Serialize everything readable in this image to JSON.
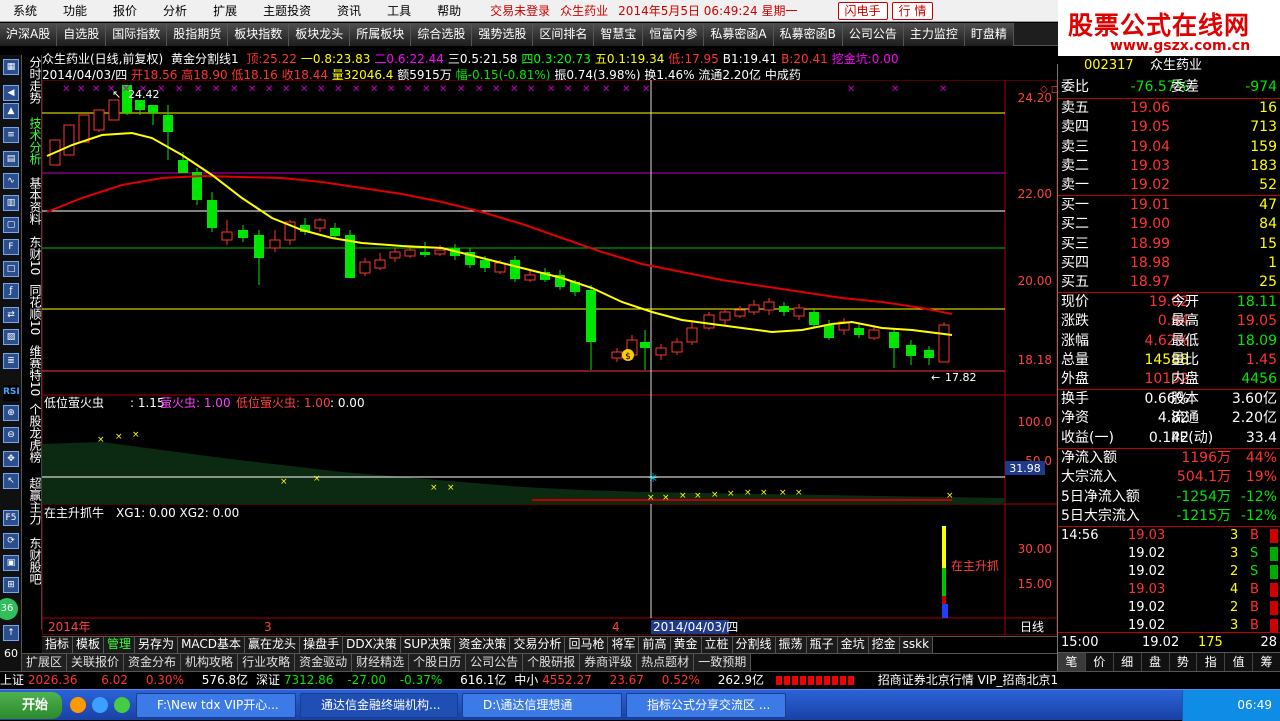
{
  "menubar": {
    "items": [
      "系统",
      "功能",
      "报价",
      "分析",
      "扩展",
      "主题投资",
      "资讯",
      "工具",
      "帮助"
    ],
    "status": "交易未登录",
    "stock": "众生药业",
    "time": "2014年5月5日 06:49:24 星期一",
    "btn1": "闪电手",
    "btn2": "行 情"
  },
  "logo": {
    "title": "股票公式在线网",
    "url": "www.gszx.com.cn"
  },
  "toolbar": [
    "沪深A股",
    "自选股",
    "国际指数",
    "股指期货",
    "板块指数",
    "板块龙头",
    "所属板块",
    "综合选股",
    "强势选股",
    "区间排名",
    "智慧宝",
    "恒富内参",
    "私募密函A",
    "私募密函B",
    "公司公告",
    "主力监控",
    "盯盘精"
  ],
  "leftbar": {
    "vtexts": [
      "分时走势",
      "技术分析",
      "基本资料",
      "东财10",
      "同花顺10",
      "维赛特10",
      "个股龙虎榜",
      "超赢主力",
      "东财股吧"
    ],
    "icons": [
      "RSI",
      "F5",
      "36",
      "60"
    ]
  },
  "chart": {
    "title": "众生药业(日线,前复权)",
    "indicator": "黄金分割线1",
    "lines": [
      {
        "label": "顶:",
        "value": "25.22",
        "color": "#ff3232"
      },
      {
        "label": "一0.8:",
        "value": "23.83",
        "color": "#ffff00"
      },
      {
        "label": "二0.6:",
        "value": "22.44",
        "color": "#ff00ff"
      },
      {
        "label": "三0.5:",
        "value": "21.58",
        "color": "#ffffff"
      },
      {
        "label": "四0.3:",
        "value": "20.73",
        "color": "#00ff00"
      },
      {
        "label": "五0.1:",
        "value": "19.34",
        "color": "#ffff00"
      },
      {
        "label": "低:",
        "value": "17.95",
        "color": "#ff3232"
      },
      {
        "label": "B1:",
        "value": "19.41",
        "color": "#ffffff"
      },
      {
        "label": "B:",
        "value": "20.41",
        "color": "#ff3232"
      },
      {
        "label": "挖金坑:",
        "value": "0.00",
        "color": "#ff00ff"
      }
    ],
    "info": {
      "date": "2014/04/03/四",
      "open": "开18.56",
      "high": "高18.90",
      "low": "低18.16",
      "close": "收18.44",
      "vol": "量32046.4",
      "amount": "额5915万",
      "change": "幅-0.15(-0.81%)",
      "amp": "振0.74(3.98%)",
      "turnover": "换1.46%",
      "float": "流通2.20亿",
      "sector": "中成药"
    },
    "price_axis": [
      "24.20",
      "22.00",
      "20.00",
      "18.18"
    ],
    "annot_high": "24.42",
    "annot_low": "17.82",
    "sub1_title": "低位萤火虫",
    "sub1_a": ": 1.15",
    "sub1_b": "萤火虫: 1.00",
    "sub1_c": "低位萤火虫: 1.00",
    "sub1_d": ": 0.00",
    "sub1_axis": [
      "100.0",
      "50.0"
    ],
    "sub1_mark": "31.98",
    "sub2_title": "在主升抓牛",
    "sub2_vals": "XG1: 0.00  XG2: 0.00",
    "sub2_axis": [
      "30.00",
      "15.00"
    ],
    "sub2_annot": "在主升抓",
    "xaxis": {
      "y2014": "2014年",
      "m3": "3",
      "m4": "4",
      "cursor": "2014/04/03/四",
      "period": "日线"
    }
  },
  "bottombar": [
    "指标",
    "模板",
    "管理",
    "另存为",
    "MACD基本",
    "赢在龙头",
    "操盘手",
    "DDX决策",
    "SUP决策",
    "资金决策",
    "交易分析",
    "回马枪",
    "将军",
    "前高",
    "黄金",
    "立桩",
    "分割线",
    "振荡",
    "瓶子",
    "金坑",
    "挖金",
    "sskk"
  ],
  "bottombar2": [
    "扩展区",
    "关联报价",
    "资金分布",
    "机构攻略",
    "行业攻略",
    "资金驱动",
    "财经精选",
    "个股日历",
    "公司公告",
    "个股研报",
    "券商评级",
    "热点题材",
    "一致预期"
  ],
  "quote": {
    "code": "002317",
    "name": "众生药业",
    "weibi": {
      "label": "委比",
      "value": "-76.57%",
      "label2": "委差",
      "value2": "-974"
    },
    "asks": [
      {
        "label": "卖五",
        "price": "19.06",
        "vol": "16"
      },
      {
        "label": "卖四",
        "price": "19.05",
        "vol": "713"
      },
      {
        "label": "卖三",
        "price": "19.04",
        "vol": "159"
      },
      {
        "label": "卖二",
        "price": "19.03",
        "vol": "183"
      },
      {
        "label": "卖一",
        "price": "19.02",
        "vol": "52"
      }
    ],
    "bids": [
      {
        "label": "买一",
        "price": "19.01",
        "vol": "47"
      },
      {
        "label": "买二",
        "price": "19.00",
        "vol": "84"
      },
      {
        "label": "买三",
        "price": "18.99",
        "vol": "15"
      },
      {
        "label": "买四",
        "price": "18.98",
        "vol": "1"
      },
      {
        "label": "买五",
        "price": "18.97",
        "vol": "25"
      }
    ],
    "stats": [
      {
        "l1": "现价",
        "v1": "19.02",
        "c1": "red",
        "l2": "今开",
        "v2": "18.11",
        "c2": "grn"
      },
      {
        "l1": "涨跌",
        "v1": "0.84",
        "c1": "red",
        "l2": "最高",
        "v2": "19.05",
        "c2": "red"
      },
      {
        "l1": "涨幅",
        "v1": "4.62%",
        "c1": "red",
        "l2": "最低",
        "v2": "18.09",
        "c2": "grn"
      },
      {
        "l1": "总量",
        "v1": "14588",
        "c1": "yel",
        "l2": "量比",
        "v2": "1.45",
        "c2": "red"
      },
      {
        "l1": "外盘",
        "v1": "10132",
        "c1": "red",
        "l2": "内盘",
        "v2": "4456",
        "c2": "grn"
      }
    ],
    "stats2": [
      {
        "l1": "换手",
        "v1": "0.66%",
        "l2": "股本",
        "v2": "3.60亿"
      },
      {
        "l1": "净资",
        "v1": "4.82",
        "l2": "流通",
        "v2": "2.20亿"
      },
      {
        "l1": "收益(一)",
        "v1": "0.142",
        "l2": "PE(动)",
        "v2": "33.4"
      }
    ],
    "flows": [
      {
        "label": "净流入额",
        "value": "1196万",
        "pct": "44%",
        "c": "red"
      },
      {
        "label": "大宗流入",
        "value": "504.1万",
        "pct": "19%",
        "c": "red"
      },
      {
        "label": "5日净流入额",
        "value": "-1254万",
        "pct": "-12%",
        "c": "grn"
      },
      {
        "label": "5日大宗流入",
        "value": "-1215万",
        "pct": "-12%",
        "c": "grn"
      }
    ],
    "ticks": [
      {
        "time": "14:56",
        "price": "19.03",
        "vol": "3",
        "bs": "B"
      },
      {
        "time": "",
        "price": "19.02",
        "vol": "3",
        "bs": "S"
      },
      {
        "time": "",
        "price": "19.02",
        "vol": "2",
        "bs": "S"
      },
      {
        "time": "",
        "price": "19.03",
        "vol": "4",
        "bs": "B"
      },
      {
        "time": "",
        "price": "19.02",
        "vol": "2",
        "bs": "B"
      },
      {
        "time": "",
        "price": "19.02",
        "vol": "3",
        "bs": "B"
      }
    ],
    "lasttick": {
      "time": "15:00",
      "price": "19.02",
      "vol": "175",
      "num": "28"
    },
    "tabs": [
      "笔",
      "价",
      "细",
      "盘",
      "势",
      "指",
      "值",
      "筹"
    ]
  },
  "statusbar": {
    "sh_label": "上证",
    "sh_val": "2026.36",
    "sh_chg": "6.02",
    "sh_pct": "0.30%",
    "sh_amt": "576.8亿",
    "sz_label": "深证",
    "sz_val": "7312.86",
    "sz_chg": "-27.00",
    "sz_pct": "-0.37%",
    "sz_amt": "616.1亿",
    "zx_label": "中小",
    "zx_val": "4552.27",
    "zx_chg": "23.67",
    "zx_pct": "0.52%",
    "zx_amt": "262.9亿",
    "broker": "招商证券北京行情  VIP_招商北京1"
  },
  "taskbar": {
    "start": "开始",
    "tasks": [
      "F:\\New tdx VIP开心...",
      "通达信金融终端机构...",
      "D:\\通达信理想通",
      "指标公式分享交流区 ..."
    ],
    "clock": "06:49"
  },
  "colors": {
    "up": "#ff3232",
    "down": "#00e600",
    "ma_short": "#ffff00",
    "ma_long": "#e00000"
  }
}
